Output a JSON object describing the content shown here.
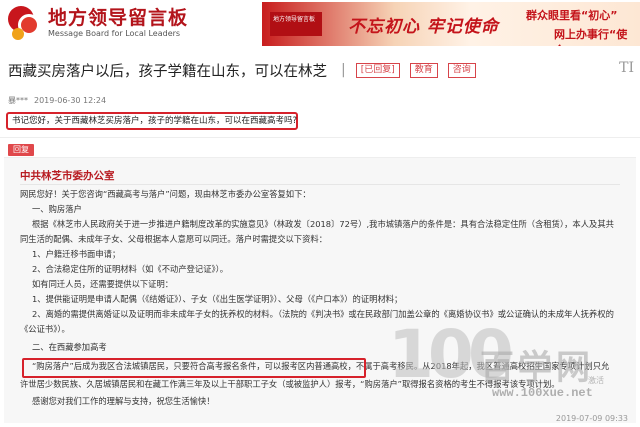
{
  "header": {
    "logo_cn": "地方领导留言板",
    "logo_en": "Message Board for Local Leaders",
    "banner_tag": "地方领导留言板",
    "banner_slogan": "不忘初心 牢记使命",
    "banner_line1": "群众眼里看“初心”",
    "banner_line2": "网上办事行“使命”"
  },
  "message": {
    "title": "西藏买房落户以后，孩子学籍在山东，可以在林芝",
    "separator": "|",
    "tag_replied": "[已回复]",
    "tag_education": "教育",
    "tag_consult": "咨询",
    "ti": "TI",
    "user": "暴***",
    "time": "2019-06-30 12:24",
    "question": "书记您好，关于西藏林芝买房落户，孩子的学籍在山东，可以在西藏高考吗?"
  },
  "reply": {
    "badge": "回复",
    "org": "中共林芝市委办公室",
    "lines": [
      "网民您好！关于您咨询“西藏高考与落户”问题，现由林芝市委办公室答复如下：",
      "一、购房落户",
      "根据《林芝市人民政府关于进一步推进户籍制度改革的实施意见》（林政发〔2018〕72号）,我市城镇落户的条件是：具有合法稳定住所（含租赁），本人及其共",
      "同生活的配偶、未成年子女、父母根据本人意愿可以同迁。落户时需提交以下资料：",
      "1、户籍迁移书面申请；",
      "2、合法稳定住所的证明材料（如《不动产登记证》）。",
      "如有同迁人员，还需要提供以下证明：",
      "1、提供能证明是申请人配偶（《结婚证》）、子女（《出生医学证明》）、父母（《户口本》）的证明材料；",
      "2、离婚的需提供离婚证以及证明而非未成年子女的抚养权的材料。（法院的《判决书》或在民政部门加盖公章的《离婚协议书》或公证确认的未成年人抚养权的",
      "《公证书》）。",
      "二、在西藏参加高考",
      "“购房落户”后成为我区合法城镇居民，只要符合高考报名条件，可以报考区内普通高校，不属于高考移民。从2018年起，我区普通高校招生国家专项计划只允",
      "许世居少数民族、久居城镇居民和在藏工作满三年及以上干部职工子女（或被监护人）报考，“购房落户”取得报名资格的考生不得报考该专项计划。",
      "感谢您对我们工作的理解与支持，祝您生活愉快！"
    ]
  },
  "watermark": {
    "big": "100",
    "cn": "百学网",
    "url": "www.100xue.net",
    "activate": "激活",
    "date": "2019-07-09 09:33"
  }
}
